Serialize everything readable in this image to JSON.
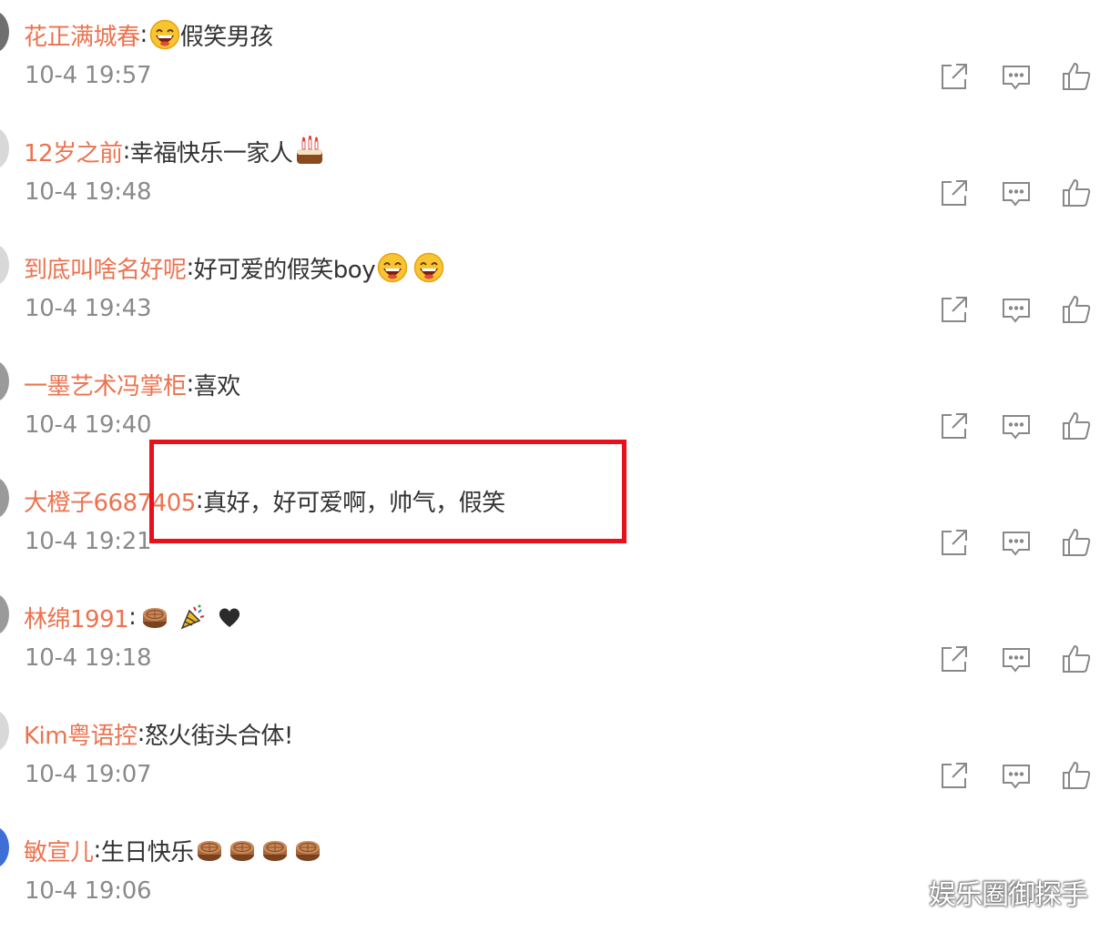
{
  "comments": [
    {
      "user": "花正满城春",
      "sep": ":",
      "text_before": "",
      "text": "假笑男孩",
      "emojis_before": [
        "laughing-emoji"
      ],
      "emojis_after": [],
      "time": "10-4 19:57"
    },
    {
      "user": "12岁之前",
      "sep": ":",
      "text": "幸福快乐一家人",
      "emojis_after": [
        "cake-emoji"
      ],
      "time": "10-4 19:48"
    },
    {
      "user": "到底叫啥名好呢",
      "sep": ":",
      "text": "好可爱的假笑boy",
      "emojis_after": [
        "laughing-emoji",
        "laughing-emoji"
      ],
      "time": "10-4 19:43"
    },
    {
      "user": "一墨艺术冯掌柜",
      "sep": ":",
      "text": "喜欢",
      "emojis_after": [],
      "time": "10-4 19:40"
    },
    {
      "user": "大橙子6687405",
      "sep": ":",
      "text": "真好，好可爱啊，帅气，假笑",
      "emojis_after": [],
      "time": "10-4 19:21"
    },
    {
      "user": "林绵1991",
      "sep": ":",
      "text": "",
      "emojis_after": [
        "mooncake-emoji",
        "party-popper-emoji",
        "black-heart-emoji"
      ],
      "time": "10-4 19:18"
    },
    {
      "user": "Kim粤语控",
      "sep": ":",
      "text": "怒火街头合体!",
      "emojis_after": [],
      "time": "10-4 19:07"
    },
    {
      "user": "敏宣儿",
      "sep": ":",
      "text": "生日快乐",
      "emojis_after": [
        "mooncake-emoji",
        "mooncake-emoji",
        "mooncake-emoji",
        "mooncake-emoji"
      ],
      "time": "10-4 19:06"
    }
  ],
  "actions": {
    "forward_icon": "forward-icon",
    "comment_icon": "comment-icon",
    "like_icon": "like-icon"
  },
  "colors": {
    "username": "#eb7350",
    "text": "#333333",
    "time": "#8a8a8a",
    "highlight_border": "#e8101a",
    "icon": "#888888"
  },
  "watermark": "娱乐圈御探手"
}
